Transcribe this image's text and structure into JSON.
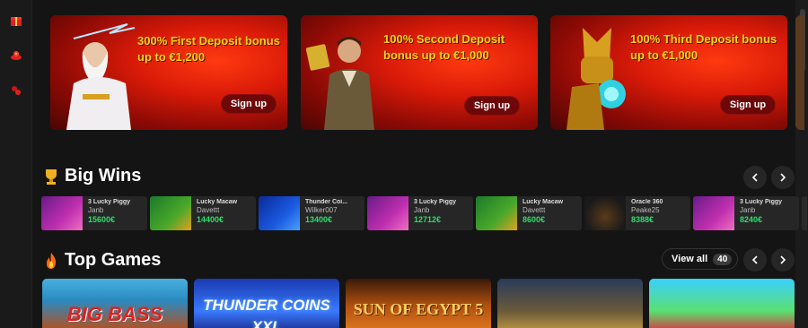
{
  "sidebar": {
    "icons": [
      "gift-icon",
      "casino-icon",
      "bonus-icon"
    ]
  },
  "promos": [
    {
      "text": "300% First Deposit bonus up to €1,200",
      "button": "Sign up"
    },
    {
      "text": "100% Second Deposit bonus up to €1,000",
      "button": "Sign up"
    },
    {
      "text": "100% Third Deposit bonus up to €1,000",
      "button": "Sign up"
    }
  ],
  "big_wins": {
    "title": "Big Wins",
    "items": [
      {
        "game": "3 Lucky Piggy",
        "user": "Janb",
        "amount": "15600€",
        "thumb_text": "3 Lucky Piggy"
      },
      {
        "game": "Lucky Macaw",
        "user": "Davettt",
        "amount": "14400€",
        "thumb_text": "Lucky Macaw"
      },
      {
        "game": "Thunder Coi...",
        "user": "Wilker007",
        "amount": "13400€",
        "thumb_text": "THUNDER COINS XXL"
      },
      {
        "game": "3 Lucky Piggy",
        "user": "Janb",
        "amount": "12712€",
        "thumb_text": "3 Lucky Piggy"
      },
      {
        "game": "Lucky Macaw",
        "user": "Davettt",
        "amount": "8600€",
        "thumb_text": "Lucky Macaw"
      },
      {
        "game": "Oracle 360",
        "user": "Peake25",
        "amount": "8388€",
        "thumb_text": "Oracle 360"
      },
      {
        "game": "3 Lucky Piggy",
        "user": "Janb",
        "amount": "8240€",
        "thumb_text": "3 Lucky Piggy"
      }
    ]
  },
  "top_games": {
    "title": "Top Games",
    "view_all": "View all",
    "count": "40",
    "items": [
      {
        "label": "BIG BASS"
      },
      {
        "label": "THUNDER COINS XXL"
      },
      {
        "label": "SUN OF EGYPT 5"
      },
      {
        "label": ""
      },
      {
        "label": ""
      }
    ]
  },
  "colors": {
    "accent_green": "#2fdc6a",
    "promo_yellow": "#ffd21a",
    "promo_red": "#d91a08"
  }
}
